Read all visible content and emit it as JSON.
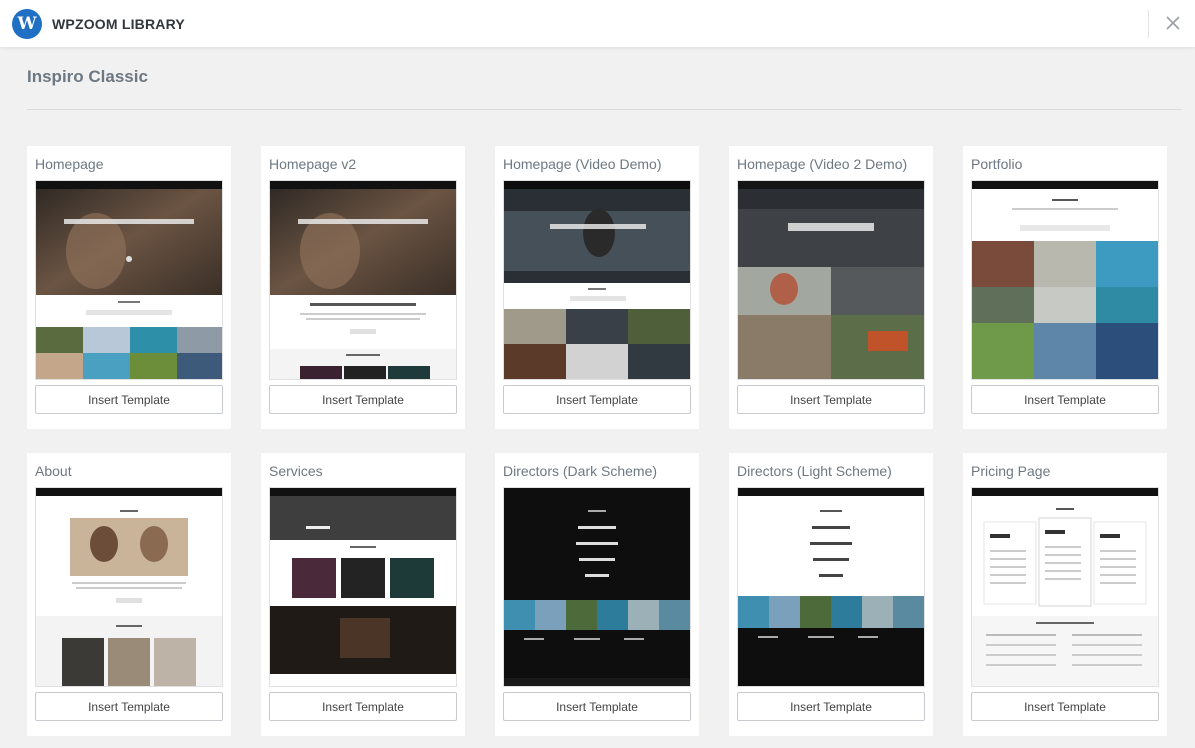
{
  "header": {
    "brand": "WPZOOM LIBRARY",
    "logo_letter": "W",
    "close_icon": "close-icon"
  },
  "section": {
    "title": "Inspiro Classic"
  },
  "templates": [
    {
      "title": "Homepage",
      "button": "Insert Template"
    },
    {
      "title": "Homepage v2",
      "button": "Insert Template"
    },
    {
      "title": "Homepage (Video Demo)",
      "button": "Insert Template"
    },
    {
      "title": "Homepage (Video 2 Demo)",
      "button": "Insert Template"
    },
    {
      "title": "Portfolio",
      "button": "Insert Template"
    },
    {
      "title": "About",
      "button": "Insert Template"
    },
    {
      "title": "Services",
      "button": "Insert Template"
    },
    {
      "title": "Directors (Dark Scheme)",
      "button": "Insert Template"
    },
    {
      "title": "Directors (Light Scheme)",
      "button": "Insert Template"
    },
    {
      "title": "Pricing Page",
      "button": "Insert Template"
    }
  ]
}
